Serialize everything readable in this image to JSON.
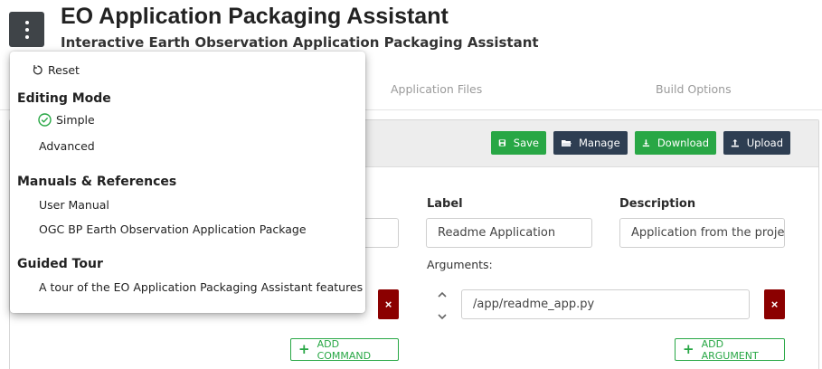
{
  "header": {
    "title": "EO Application Packaging Assistant",
    "subtitle": "Interactive Earth Observation Application Packaging Assistant"
  },
  "tabs": [
    {
      "label": "Application Files"
    },
    {
      "label": "Build Options"
    }
  ],
  "toolbar": {
    "save_label": "Save",
    "manage_label": "Manage",
    "download_label": "Download",
    "upload_label": "Upload"
  },
  "form": {
    "label_title": "Label",
    "label_value": "Readme Application",
    "description_title": "Description",
    "description_value": "Application from the projec",
    "arguments_title": "Arguments:",
    "argument_value": "/app/readme_app.py",
    "delete_glyph": "×",
    "add_command_label": "ADD COMMAND",
    "add_argument_label": "ADD ARGUMENT"
  },
  "menu": {
    "reset_label": "Reset",
    "editing_mode_heading": "Editing Mode",
    "simple_label": "Simple",
    "advanced_label": "Advanced",
    "manuals_heading": "Manuals & References",
    "user_manual_label": "User Manual",
    "ogc_label": "OGC BP Earth Observation Application Package",
    "guided_tour_heading": "Guided Tour",
    "tour_label": "A tour of the EO Application Packaging Assistant features"
  },
  "colors": {
    "primary_green": "#28a745",
    "dark_navy": "#2e3e52",
    "danger_red": "#8b0000",
    "menu_button": "#3f4448"
  },
  "icons": {
    "menu": "vertical-dots-icon",
    "reset": "reset-icon",
    "selected": "check-circle-icon",
    "save": "floppy-icon",
    "manage": "folder-open-icon",
    "download": "download-icon",
    "upload": "upload-icon",
    "sort": "chevron-up-down-icon",
    "add": "plus-icon"
  }
}
